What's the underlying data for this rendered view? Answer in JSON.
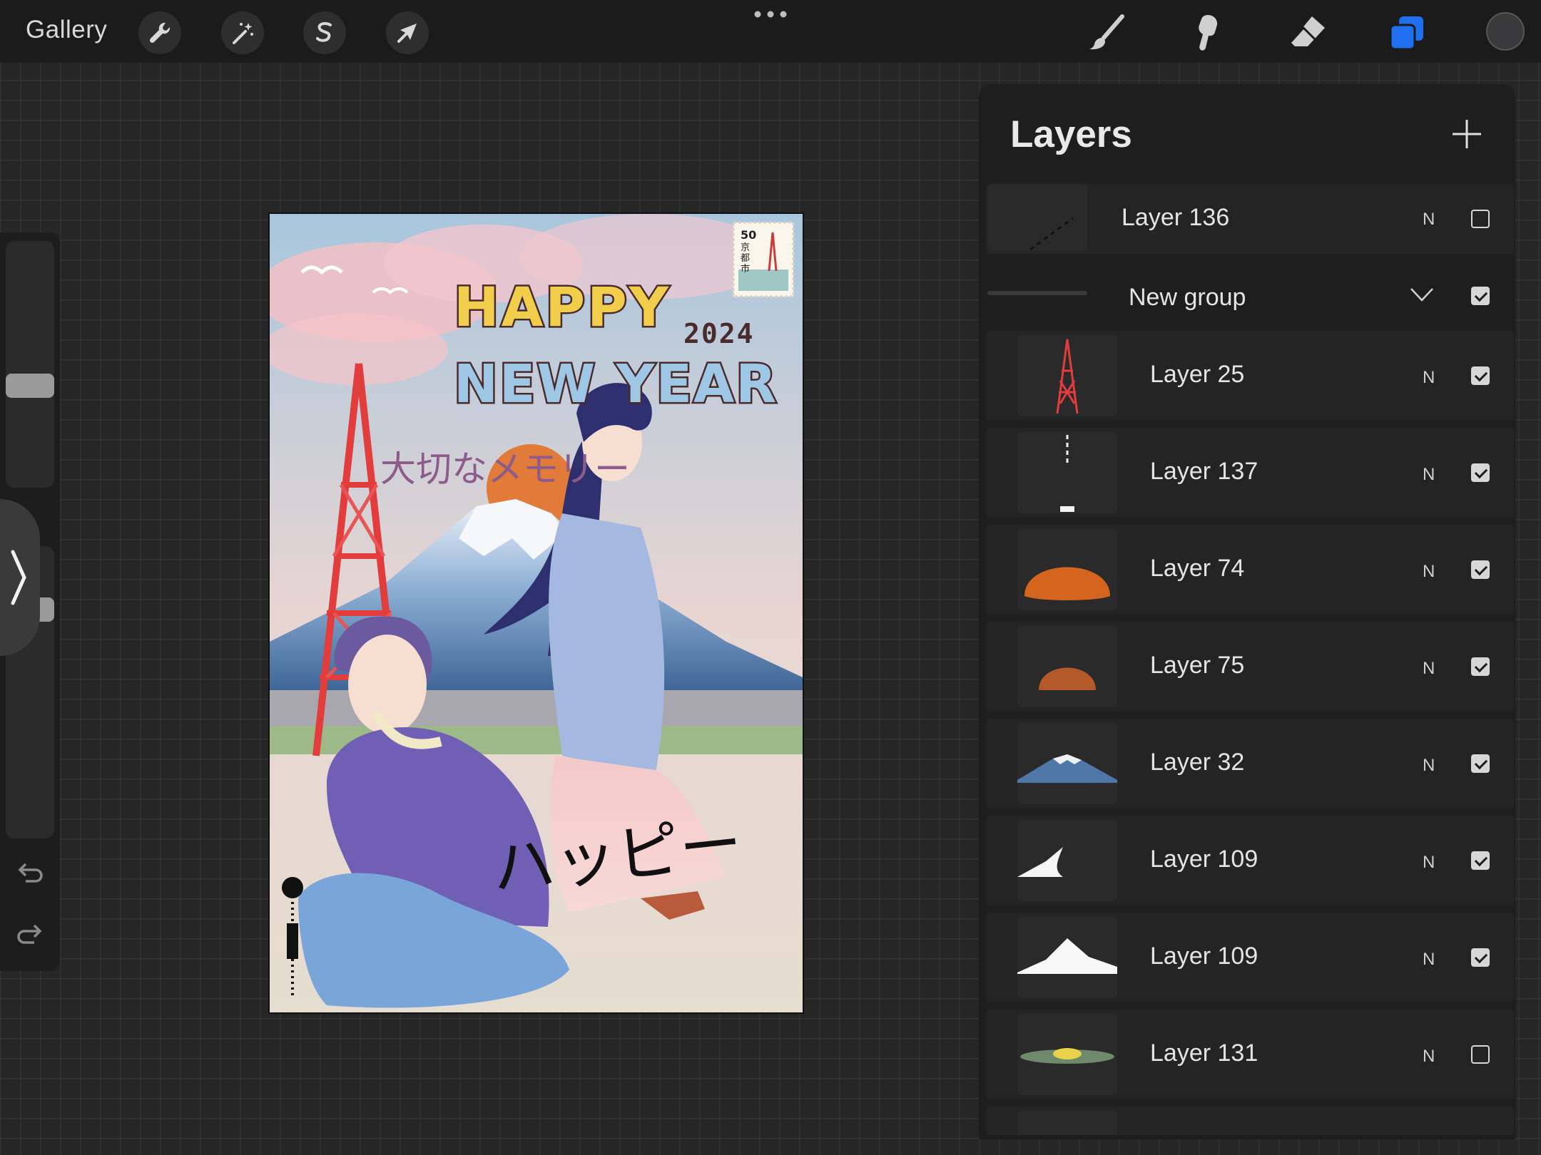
{
  "topbar": {
    "gallery_label": "Gallery",
    "tools": [
      "wrench-icon",
      "magic-wand-icon",
      "selection-s-icon",
      "transform-arrow-icon"
    ],
    "right_tools": [
      "brush-icon",
      "smudge-icon",
      "eraser-icon",
      "layers-icon"
    ],
    "accent_color": "#1f6ff0"
  },
  "artwork": {
    "heading_line1": "HAPPY",
    "heading_line2": "NEW YEAR",
    "year": "2024",
    "subtitle_jp": "大切なメモリー",
    "handwriting_jp": "ハッピー",
    "stamp_number": "50",
    "stamp_text": "京都市"
  },
  "layers": {
    "title": "Layers",
    "items": [
      {
        "name": "Layer 136",
        "blend": "N",
        "visible": false,
        "thumb": "dashed-line"
      },
      {
        "name": "New group",
        "blend": "",
        "visible": true,
        "thumb": "group"
      },
      {
        "name": "Layer 25",
        "blend": "N",
        "visible": true,
        "thumb": "tower"
      },
      {
        "name": "Layer 137",
        "blend": "N",
        "visible": true,
        "thumb": "marks"
      },
      {
        "name": "Layer 74",
        "blend": "N",
        "visible": true,
        "thumb": "sun-large"
      },
      {
        "name": "Layer 75",
        "blend": "N",
        "visible": true,
        "thumb": "sun-small"
      },
      {
        "name": "Layer 32",
        "blend": "N",
        "visible": true,
        "thumb": "mountain"
      },
      {
        "name": "Layer 109",
        "blend": "N",
        "visible": true,
        "thumb": "snow-left"
      },
      {
        "name": "Layer 109",
        "blend": "N",
        "visible": true,
        "thumb": "snow-cap"
      },
      {
        "name": "Layer 131",
        "blend": "N",
        "visible": false,
        "thumb": "horizon"
      }
    ]
  }
}
